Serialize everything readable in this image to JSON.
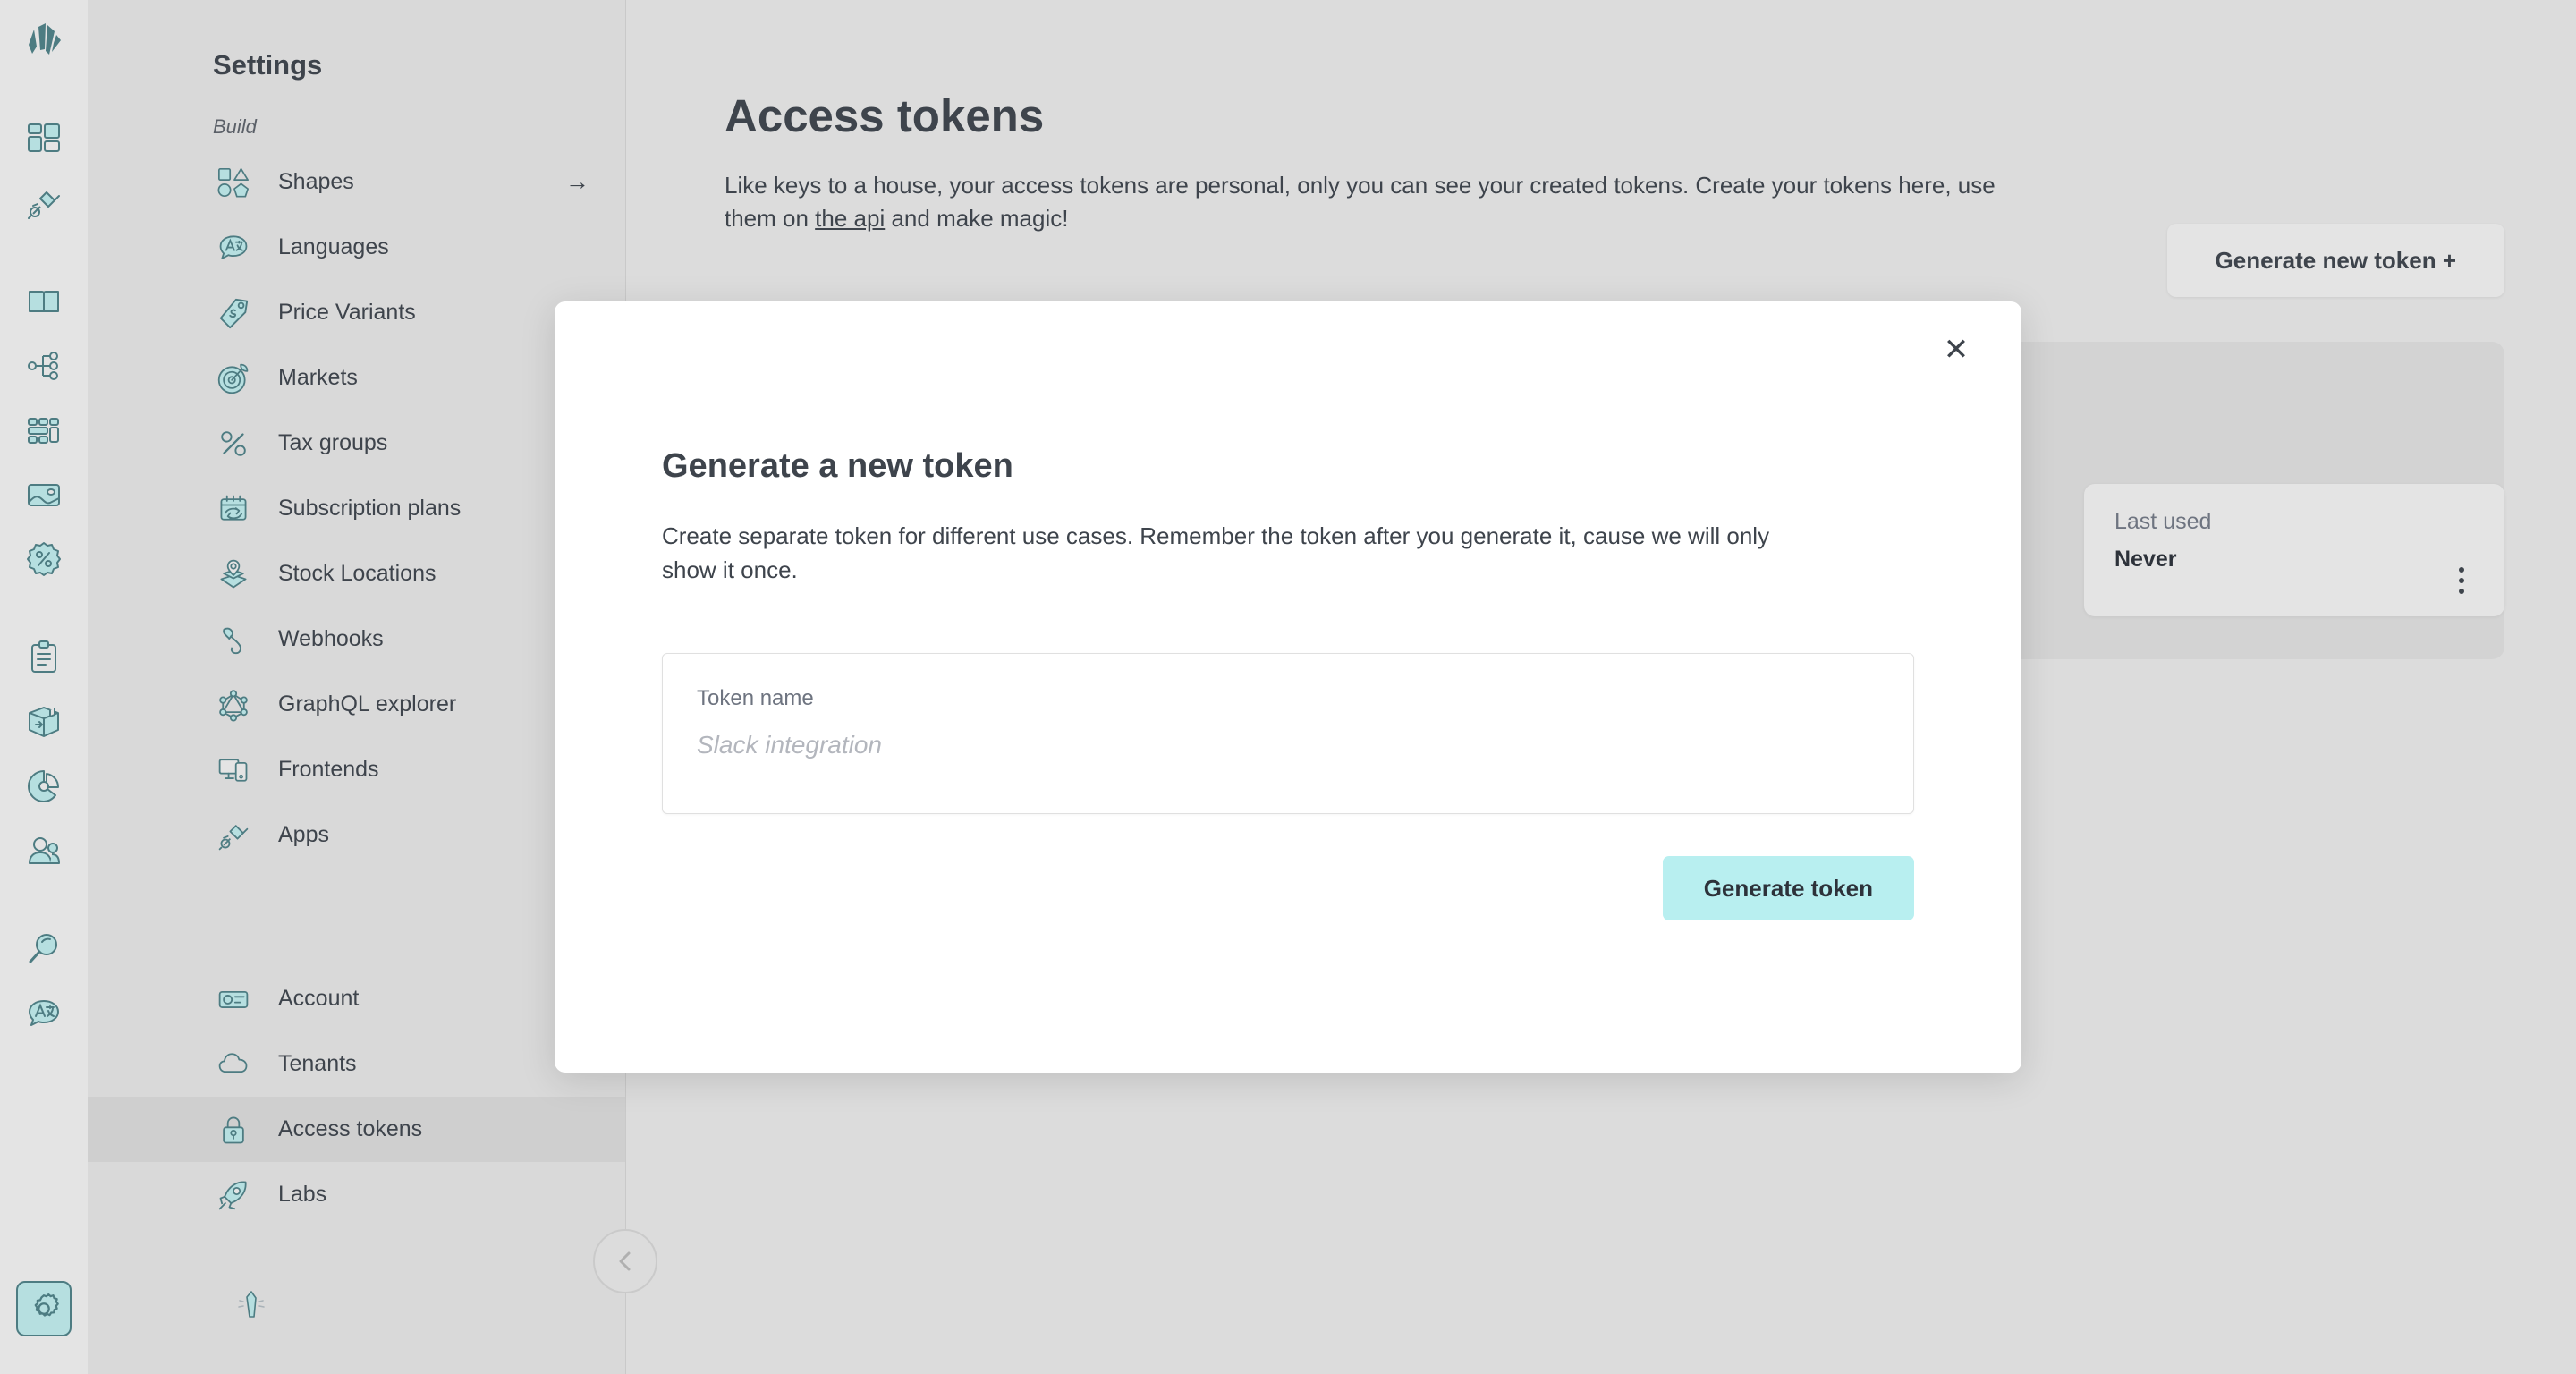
{
  "rail": {
    "logo": "crystallize-logo-icon",
    "top_items": [
      {
        "icon": "dashboard-grid-icon"
      },
      {
        "icon": "plug-apps-icon"
      }
    ],
    "mid_items": [
      {
        "icon": "book-catalogue-icon"
      },
      {
        "icon": "sitemap-topics-icon"
      },
      {
        "icon": "grids-layout-icon"
      },
      {
        "icon": "image-media-icon"
      },
      {
        "icon": "discount-badge-icon"
      }
    ],
    "low_items": [
      {
        "icon": "clipboard-orders-icon"
      },
      {
        "icon": "package-box-icon"
      },
      {
        "icon": "pie-chart-analytics-icon"
      },
      {
        "icon": "people-customers-icon"
      },
      {
        "icon": "search-magnifier-icon"
      },
      {
        "icon": "translate-language-icon"
      }
    ],
    "settings_item": {
      "icon": "gear-settings-icon",
      "active": true
    }
  },
  "sidebar": {
    "title": "Settings",
    "section_label": "Build",
    "build_items": [
      {
        "label": "Shapes",
        "icon": "shapes-icon",
        "arrow": "→"
      },
      {
        "label": "Languages",
        "icon": "translate-language-icon"
      },
      {
        "label": "Price Variants",
        "icon": "price-tag-icon"
      },
      {
        "label": "Markets",
        "icon": "target-markets-icon"
      },
      {
        "label": "Tax groups",
        "icon": "percent-tax-icon"
      },
      {
        "label": "Subscription plans",
        "icon": "subscription-calendar-icon"
      },
      {
        "label": "Stock Locations",
        "icon": "stock-box-pin-icon"
      },
      {
        "label": "Webhooks",
        "icon": "hook-icon"
      },
      {
        "label": "GraphQL explorer",
        "icon": "graphql-icon"
      },
      {
        "label": "Frontends",
        "icon": "devices-frontends-icon"
      },
      {
        "label": "Apps",
        "icon": "plug-apps-icon"
      }
    ],
    "account_items": [
      {
        "label": "Account",
        "icon": "id-card-account-icon",
        "active": false
      },
      {
        "label": "Tenants",
        "icon": "cloud-tenants-icon",
        "active": false
      },
      {
        "label": "Access tokens",
        "icon": "lock-tokens-icon",
        "active": true
      },
      {
        "label": "Labs",
        "icon": "rocket-labs-icon",
        "active": false
      }
    ],
    "footer_logo": "crystallize-small-logo-icon",
    "collapse_button": {
      "icon": "chevron-left-icon"
    }
  },
  "main": {
    "page_title": "Access tokens",
    "description_before_link": "Like keys to a house, your access tokens are personal, only you can see your created tokens. Create your tokens here, use them on ",
    "link_text": "the api",
    "description_after_link": " and make magic!",
    "generate_new_token_label": "Generate new token +",
    "token_card": {
      "last_used_label": "Last used",
      "last_used_value": "Never",
      "menu_icon": "kebab-menu-icon"
    }
  },
  "modal": {
    "close_icon": "close-icon",
    "close_glyph": "✕",
    "title": "Generate a new token",
    "description": "Create separate token for different use cases. Remember the token after you generate it, cause we will only show it once.",
    "field": {
      "label": "Token name",
      "value": "",
      "placeholder": "Slack integration"
    },
    "submit_label": "Generate token"
  },
  "colors": {
    "accent_teal": "#b8eff0",
    "icon_fill": "#b6dfe0",
    "icon_stroke": "#4d7c82",
    "text": "#3e444c",
    "bg": "#dcdcdc",
    "sidebar_bg": "#d9d9d9",
    "rail_bg": "#e4e4e4"
  }
}
